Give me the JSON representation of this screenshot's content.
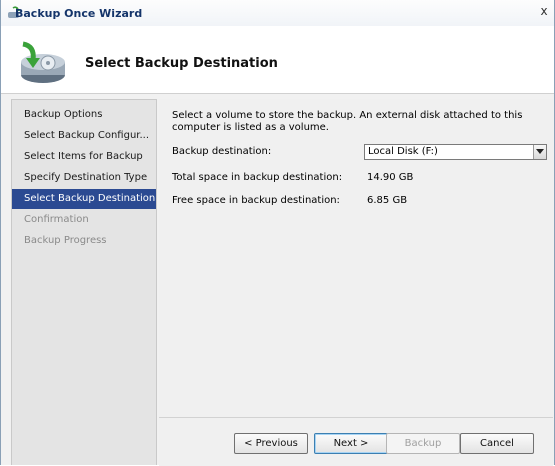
{
  "window": {
    "title": "Backup Once Wizard",
    "close_glyph": "x"
  },
  "header": {
    "page_title": "Select Backup Destination",
    "icon": "backup-wizard-icon"
  },
  "nav": {
    "items": [
      {
        "label": "Backup Options",
        "state": "done"
      },
      {
        "label": "Select Backup Configur...",
        "state": "done"
      },
      {
        "label": "Select Items for Backup",
        "state": "done"
      },
      {
        "label": "Specify Destination Type",
        "state": "done"
      },
      {
        "label": "Select Backup Destination",
        "state": "active"
      },
      {
        "label": "Confirmation",
        "state": "disabled"
      },
      {
        "label": "Backup Progress",
        "state": "disabled"
      }
    ]
  },
  "content": {
    "intro": "Select a volume to store the backup. An external disk attached to this computer is listed as a volume.",
    "destination_label": "Backup destination:",
    "destination_value": "Local Disk (F:)",
    "total_label": "Total space in backup destination:",
    "total_value": "14.90 GB",
    "free_label": "Free space in backup destination:",
    "free_value": "6.85 GB"
  },
  "footer": {
    "previous_label": "< Previous",
    "next_label": "Next >",
    "backup_label": "Backup",
    "cancel_label": "Cancel"
  },
  "colors": {
    "active_nav_bg": "#2b4a92",
    "title_text": "#14346a",
    "nav_bg": "#e4e4e4"
  }
}
